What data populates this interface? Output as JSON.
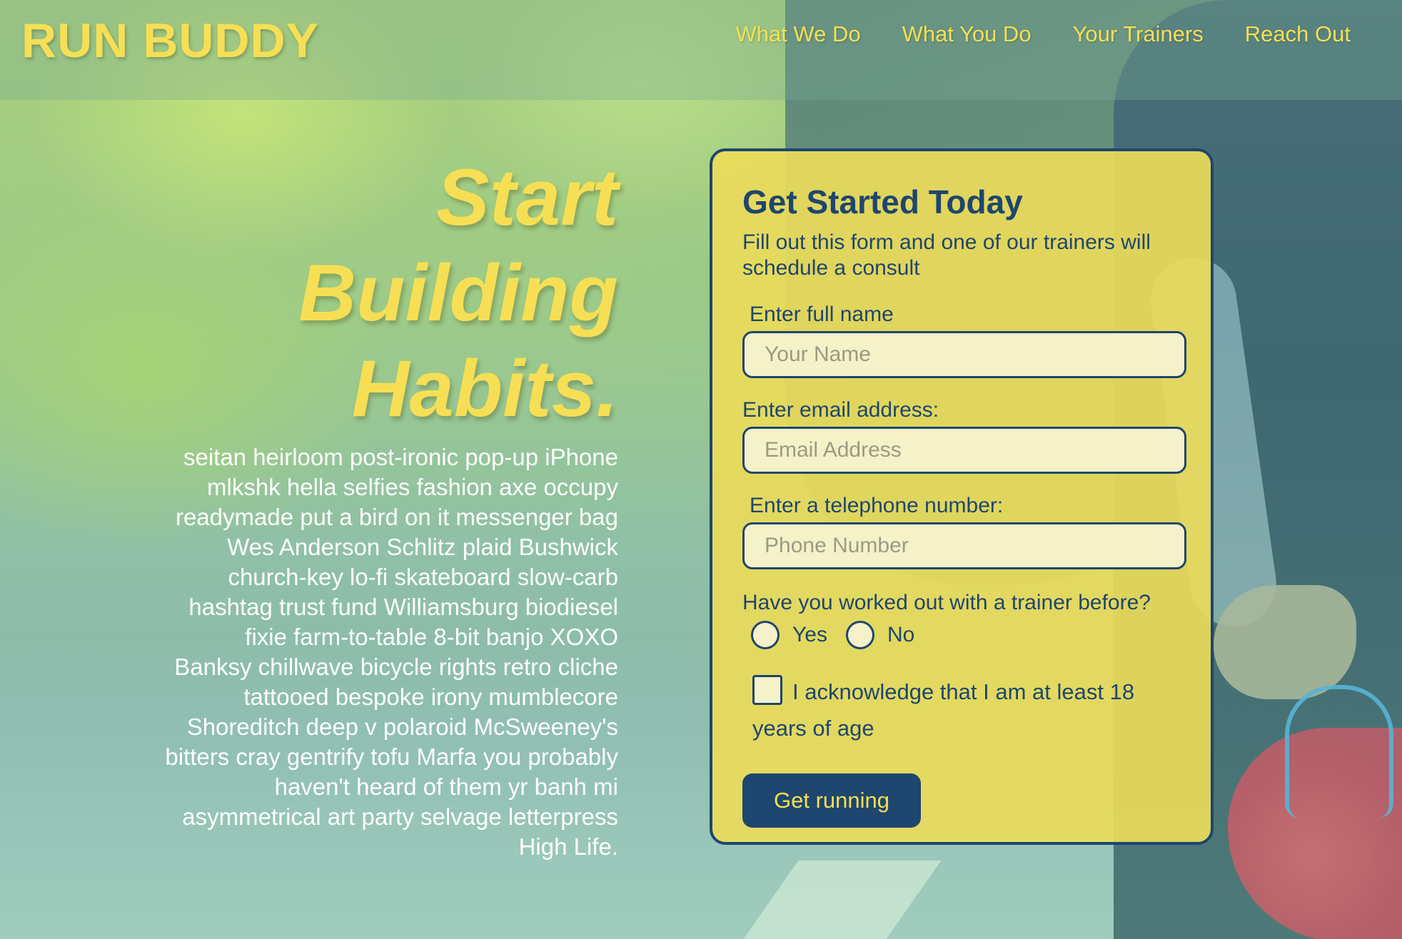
{
  "header": {
    "logo": "RUN BUDDY",
    "nav": [
      {
        "label": "What We Do"
      },
      {
        "label": "What You Do"
      },
      {
        "label": "Your Trainers"
      },
      {
        "label": "Reach Out"
      }
    ]
  },
  "hero": {
    "title_line1": "Start",
    "title_line2": "Building",
    "title_line3": "Habits.",
    "body": "seitan heirloom post-ironic pop-up iPhone mlkshk hella selfies fashion axe occupy readymade put a bird on it messenger bag Wes Anderson Schlitz plaid Bushwick church-key lo-fi skateboard slow-carb hashtag trust fund Williamsburg biodiesel fixie farm-to-table 8-bit banjo XOXO Banksy chillwave bicycle rights retro cliche tattooed bespoke irony mumblecore Shoreditch deep v polaroid McSweeney's bitters cray gentrify tofu Marfa you probably haven't heard of them yr banh mi asymmetrical art party selvage letterpress High Life."
  },
  "form": {
    "title": "Get Started Today",
    "intro": "Fill out this form and one of our trainers will schedule a consult",
    "name": {
      "label": "Enter full name",
      "placeholder": "Your Name",
      "value": ""
    },
    "email": {
      "label": "Enter email address:",
      "placeholder": "Email Address",
      "value": ""
    },
    "phone": {
      "label": "Enter a telephone number:",
      "placeholder": "Phone Number",
      "value": ""
    },
    "question": "Have you worked out with a trainer before?",
    "option_yes": "Yes",
    "option_no": "No",
    "acknowledge": "I acknowledge that I am at least 18 years of age",
    "submit": "Get running"
  },
  "colors": {
    "accent_yellow": "#f6df55",
    "navy": "#1e466e",
    "card_bg": "#eadb5a",
    "input_bg": "#f5f1c9"
  }
}
